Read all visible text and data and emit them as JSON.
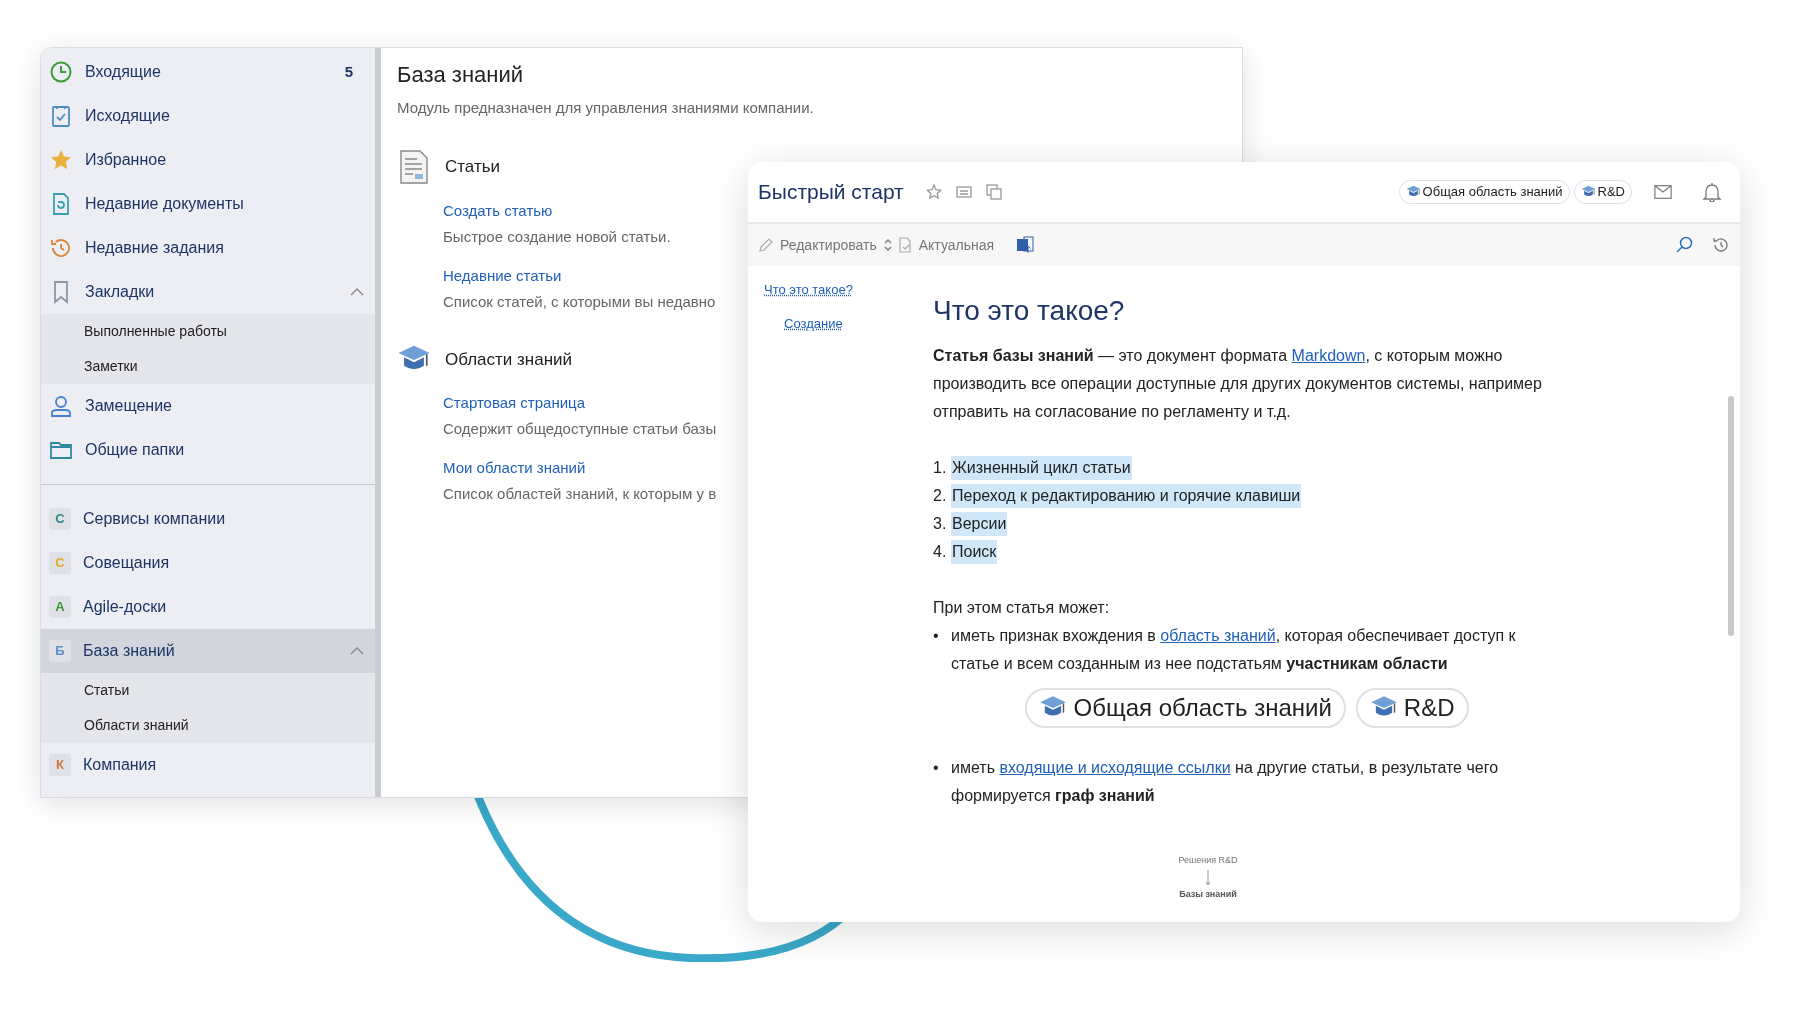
{
  "sidebar": {
    "items": [
      {
        "label": "Входящие",
        "badge": "5",
        "selected": false
      },
      {
        "label": "Исходящие",
        "selected": false
      },
      {
        "label": "Избранное",
        "selected": false
      },
      {
        "label": "Недавние документы",
        "selected": false
      },
      {
        "label": "Недавние задания",
        "selected": false
      },
      {
        "label": "Закладки",
        "expanded": true,
        "selected": false,
        "children": [
          {
            "label": "Выполненные работы"
          },
          {
            "label": "Заметки"
          }
        ]
      },
      {
        "label": "Замещение",
        "selected": false
      },
      {
        "label": "Общие папки",
        "selected": false
      },
      {
        "kind": "divider"
      },
      {
        "label": "Сервисы компании",
        "letter": "С",
        "color": "#2f8a8a",
        "selected": false
      },
      {
        "label": "Совещания",
        "letter": "С",
        "color": "#e8a92a",
        "selected": false
      },
      {
        "label": "Agile-доски",
        "letter": "A",
        "color": "#3d9a3d",
        "selected": false
      },
      {
        "label": "База знаний",
        "letter": "Б",
        "color": "#5a8fd0",
        "expanded": true,
        "selected": true,
        "children": [
          {
            "label": "Статьи"
          },
          {
            "label": "Области знаний"
          }
        ]
      },
      {
        "label": "Компания",
        "letter": "К",
        "color": "#d9733a",
        "selected": false
      }
    ]
  },
  "module": {
    "title": "База знаний",
    "description": "Модуль предназначен для управления знаниями компании.",
    "sections": [
      {
        "title": "Статьи",
        "links": [
          {
            "label": "Создать статью",
            "description": "Быстрое создание новой статьи."
          },
          {
            "label": "Недавние статьи",
            "description": "Список статей, с которыми вы недавно"
          }
        ]
      },
      {
        "title": "Области знаний",
        "links": [
          {
            "label": "Стартовая страница",
            "description": "Содержит общедоступные статьи базы"
          },
          {
            "label": "Мои области знаний",
            "description": "Список областей знаний, к которым у в"
          }
        ]
      }
    ]
  },
  "article": {
    "title": "Быстрый старт",
    "tags": [
      "Общая область знаний",
      "R&D"
    ],
    "toolbar": {
      "edit": "Редактировать",
      "status": "Актуальная"
    },
    "toc": [
      {
        "label": "Что это такое?",
        "children": [
          {
            "label": "Создание"
          }
        ]
      }
    ],
    "heading": "Что это такое?",
    "intro": [
      {
        "kind": "text",
        "text": "**Статья базы знаний** — это документ формата "
      },
      {
        "kind": "link",
        "text": "Markdown"
      },
      {
        "kind": "text",
        "text": ", с которым можно производить все операции доступные для других документов системы, например отправить на согласование по регламенту и т.д."
      }
    ],
    "list": [
      {
        "marker": "1.",
        "text": "Жизненный цикл статьи"
      },
      {
        "marker": "2.",
        "text": "Переход к редактированию и горячие клавиши"
      },
      {
        "marker": "3.",
        "text": "Версии"
      },
      {
        "marker": "4.",
        "text": "Поиск"
      }
    ],
    "lead": "При этом статья может:",
    "bullets": [
      {
        "marker": "•",
        "parts": [
          {
            "kind": "text",
            "text": "иметь признак вхождения в "
          },
          {
            "kind": "link",
            "text": "область знаний"
          },
          {
            "kind": "text",
            "text": ", которая обеспечивает доступ к статье и всем созданным из нее подстатьям **участникам области**"
          }
        ]
      },
      {
        "marker": "•",
        "parts": [
          {
            "kind": "text",
            "text": "иметь "
          },
          {
            "kind": "link",
            "text": "входящие и исходящие ссылки"
          },
          {
            "kind": "text",
            "text": " на другие статьи, в результате чего формируется **граф знаний**"
          }
        ]
      }
    ],
    "big_tags": [
      "Общая область знаний",
      "R&D"
    ],
    "graph": {
      "from": "Решения R&D",
      "to": "Базы знаний"
    }
  }
}
